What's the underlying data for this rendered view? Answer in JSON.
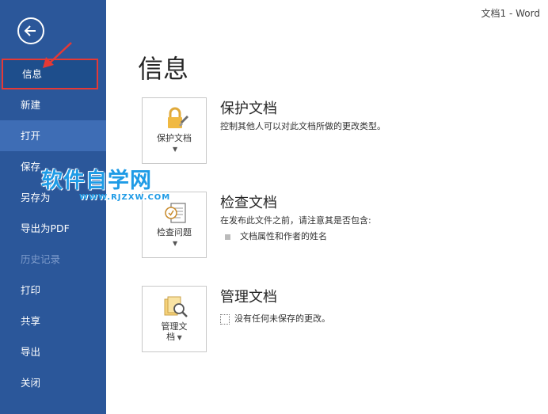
{
  "window": {
    "title": "文档1  -  Word"
  },
  "sidebar": {
    "items": [
      {
        "label": "信息"
      },
      {
        "label": "新建"
      },
      {
        "label": "打开"
      },
      {
        "label": "保存"
      },
      {
        "label": "另存为"
      },
      {
        "label": "导出为PDF"
      },
      {
        "label": "历史记录"
      },
      {
        "label": "打印"
      },
      {
        "label": "共享"
      },
      {
        "label": "导出"
      },
      {
        "label": "关闭"
      }
    ]
  },
  "main": {
    "title": "信息",
    "sections": [
      {
        "tile_label": "保护文档",
        "title": "保护文档",
        "desc": "控制其他人可以对此文档所做的更改类型。"
      },
      {
        "tile_label": "检查问题",
        "title": "检查文档",
        "desc": "在发布此文件之前，请注意其是否包含:",
        "bullet": "文档属性和作者的姓名"
      },
      {
        "tile_label_line1": "管理文",
        "tile_label_line2": "档",
        "title": "管理文档",
        "desc": "没有任何未保存的更改。"
      }
    ]
  },
  "watermark": {
    "cn": "软件自学网",
    "en": "WWW.RJZXW.COM"
  },
  "colors": {
    "sidebar": "#2b579a",
    "highlight": "#e53935",
    "watermark": "#1e9be6"
  }
}
